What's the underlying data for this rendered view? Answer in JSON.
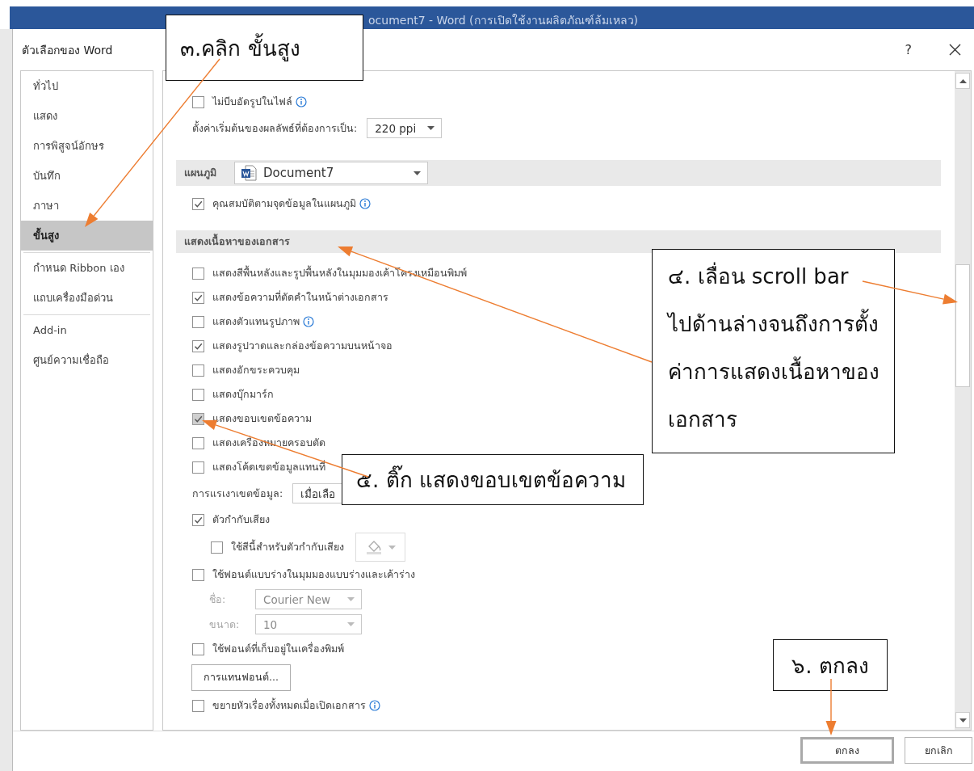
{
  "app_window": {
    "title": "ocument7 - Word (การเปิดใช้งานผลิตภัณฑ์ล้มเหลว)"
  },
  "dialog": {
    "title": "ตัวเลือกของ Word",
    "help": "?"
  },
  "sidebar": {
    "groups": [
      {
        "items": [
          {
            "label": "ทั่วไป",
            "selected": false
          },
          {
            "label": "แสดง",
            "selected": false
          },
          {
            "label": "การพิสูจน์อักษร",
            "selected": false
          },
          {
            "label": "บันทึก",
            "selected": false
          },
          {
            "label": "ภาษา",
            "selected": false
          },
          {
            "label": "ขั้นสูง",
            "selected": true
          }
        ]
      },
      {
        "items": [
          {
            "label": "กำหนด Ribbon เอง",
            "selected": false
          },
          {
            "label": "แถบเครื่องมือด่วน",
            "selected": false
          }
        ]
      },
      {
        "items": [
          {
            "label": "Add-in",
            "selected": false
          },
          {
            "label": "ศูนย์ความเชื่อถือ",
            "selected": false
          }
        ]
      }
    ]
  },
  "content": {
    "items": [
      {
        "kind": "checkbox",
        "label": "ไม่บีบอัดรูปในไฟล์",
        "checked": false,
        "hover": false,
        "info": true
      },
      {
        "kind": "setting",
        "label": "ตั้งค่าเริ่มต้นของผลลัพธ์ที่ต้องการเป็น:",
        "value": "220 ppi",
        "disabled": false
      },
      {
        "kind": "section",
        "label": "แผนภูมิ",
        "value": "Document7"
      },
      {
        "kind": "checkbox",
        "label": "คุณสมบัติตามจุดข้อมูลในแผนภูมิ",
        "checked": true,
        "hover": false,
        "info": true
      },
      {
        "kind": "section",
        "label": "แสดงเนื้อหาของเอกสาร"
      },
      {
        "kind": "checkbox",
        "label": "แสดงสีพื้นหลังและรูปพื้นหลังในมุมมองเค้าโครงเหมือนพิมพ์",
        "checked": false,
        "hover": false,
        "info": false
      },
      {
        "kind": "checkbox",
        "label": "แสดงข้อความที่ตัดคำในหน้าต่างเอกสาร",
        "checked": true,
        "hover": false,
        "info": false
      },
      {
        "kind": "checkbox",
        "label": "แสดงตัวแทนรูปภาพ",
        "checked": false,
        "hover": false,
        "info": true
      },
      {
        "kind": "checkbox",
        "label": "แสดงรูปวาดและกล่องข้อความบนหน้าจอ",
        "checked": true,
        "hover": false,
        "info": false
      },
      {
        "kind": "checkbox",
        "label": "แสดงอักขระควบคุม",
        "checked": false,
        "hover": false,
        "info": false
      },
      {
        "kind": "checkbox",
        "label": "แสดงบุ๊กมาร์ก",
        "checked": false,
        "hover": false,
        "info": false
      },
      {
        "kind": "checkbox",
        "label": "แสดงขอบเขตข้อความ",
        "checked": true,
        "hover": true,
        "info": false
      },
      {
        "kind": "checkbox",
        "label": "แสดงเครื่องหมายครอบตัด",
        "checked": false,
        "hover": false,
        "info": false
      },
      {
        "kind": "checkbox",
        "label": "แสดงโค้ดเขตข้อมูลแทนที่",
        "checked": false,
        "hover": false,
        "info": false
      },
      {
        "kind": "setting",
        "label": "การแรเงาเขตข้อมูล:",
        "value": "เมื่อเลือ",
        "disabled": false
      },
      {
        "kind": "checkbox",
        "label": "ตัวกำกับเสียง",
        "checked": true,
        "hover": false,
        "info": false,
        "children": [
          {
            "kind": "color",
            "label": "ใช้สีนี้สำหรับตัวกำกับเสียง",
            "checked": false,
            "hover": false,
            "disabled": true
          }
        ]
      },
      {
        "kind": "checkbox",
        "label": "ใช้ฟอนต์แบบร่างในมุมมองแบบร่างและเค้าร่าง",
        "checked": false,
        "hover": false,
        "info": false,
        "children": [
          {
            "kind": "setting",
            "label": "ชื่อ:",
            "value": "Courier New",
            "disabled": true
          },
          {
            "kind": "setting",
            "label": "ขนาด:",
            "value": "10",
            "disabled": true
          }
        ]
      },
      {
        "kind": "checkbox",
        "label": "ใช้ฟอนต์ที่เก็บอยู่ในเครื่องพิมพ์",
        "checked": false,
        "hover": false,
        "info": false
      },
      {
        "kind": "button",
        "label": "การแทนฟอนต์..."
      },
      {
        "kind": "checkbox",
        "label": "ขยายหัวเรื่องทั้งหมดเมื่อเปิดเอกสาร",
        "checked": false,
        "hover": false,
        "info": true
      }
    ]
  },
  "footer": {
    "buttons": [
      {
        "label": "ตกลง",
        "default": true
      },
      {
        "label": "ยกเลิก",
        "default": false
      }
    ]
  },
  "callouts": [
    {
      "lines": [
        "๓.คลิก ขั้นสูง"
      ]
    },
    {
      "lines": [
        "๔. เลื่อน  scroll bar",
        "ไปด้านล่างจนถึงการตั้ง",
        "ค่าการแสดงเนื้อหาของ",
        "เอกสาร"
      ]
    },
    {
      "lines": [
        "๕. ติ๊ก แสดงขอบเขตข้อความ"
      ]
    },
    {
      "lines": [
        "๖. ตกลง"
      ]
    }
  ]
}
